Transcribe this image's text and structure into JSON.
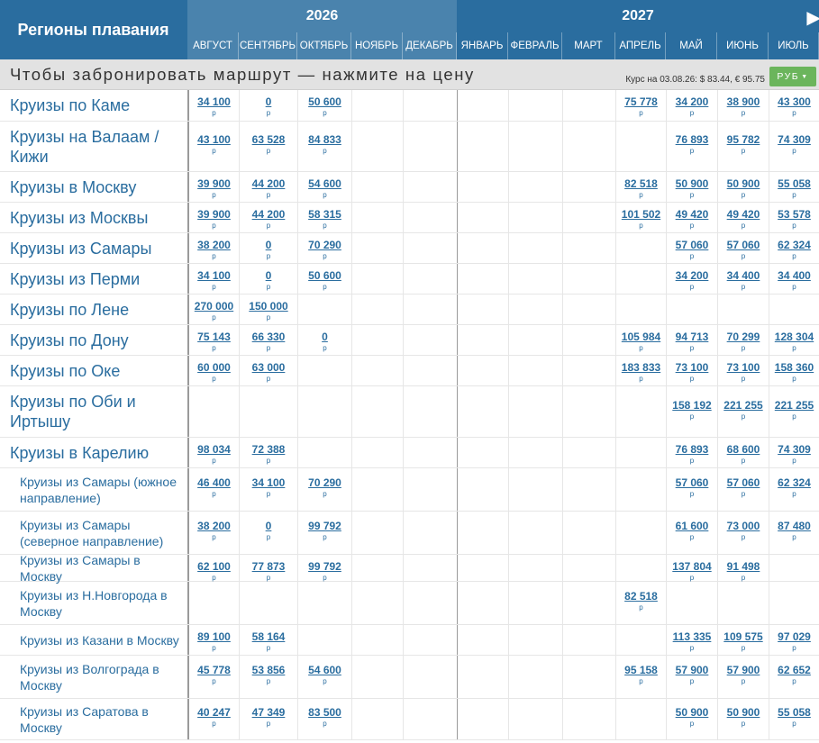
{
  "header": {
    "regions_title": "Регионы плавания",
    "years": [
      "2026",
      "2027"
    ],
    "months": [
      {
        "label": "АВГУСТ",
        "year": "2026"
      },
      {
        "label": "СЕНТЯБРЬ",
        "year": "2026"
      },
      {
        "label": "ОКТЯБРЬ",
        "year": "2026"
      },
      {
        "label": "НОЯБРЬ",
        "year": "2026"
      },
      {
        "label": "ДЕКАБРЬ",
        "year": "2026"
      },
      {
        "label": "ЯНВАРЬ",
        "year": "2027"
      },
      {
        "label": "ФЕВРАЛЬ",
        "year": "2027"
      },
      {
        "label": "МАРТ",
        "year": "2027"
      },
      {
        "label": "АПРЕЛЬ",
        "year": "2027"
      },
      {
        "label": "МАЙ",
        "year": "2027"
      },
      {
        "label": "ИЮНЬ",
        "year": "2027"
      },
      {
        "label": "ИЮЛЬ",
        "year": "2027"
      }
    ],
    "next_icon": "triangle-right-icon"
  },
  "notice": {
    "text": "Чтобы забронировать маршрут — нажмите на цену",
    "rate": "Курс на 03.08.26: $ 83.44, € 95.75",
    "currency_label": "РУБ",
    "currency_icon": "caret-down-icon"
  },
  "currency_symbol": "р",
  "colors": {
    "header": "#2a6d9f",
    "header_2026": "#4a83ad",
    "link": "#2a6d9f",
    "currency_button": "#6bb55c"
  },
  "rows": [
    {
      "name": "Круизы по Каме",
      "size": "big",
      "prices": [
        "34 100",
        "0",
        "50 600",
        "",
        "",
        "",
        "",
        "",
        "75 778",
        "34 200",
        "38 900",
        "43 300"
      ]
    },
    {
      "name": "Круизы на Валаам / Кижи",
      "size": "big",
      "prices": [
        "43 100",
        "63 528",
        "84 833",
        "",
        "",
        "",
        "",
        "",
        "",
        "76 893",
        "95 782",
        "74 309"
      ]
    },
    {
      "name": "Круизы в Москву",
      "size": "big",
      "prices": [
        "39 900",
        "44 200",
        "54 600",
        "",
        "",
        "",
        "",
        "",
        "82 518",
        "50 900",
        "50 900",
        "55 058"
      ]
    },
    {
      "name": "Круизы из Москвы",
      "size": "big",
      "prices": [
        "39 900",
        "44 200",
        "58 315",
        "",
        "",
        "",
        "",
        "",
        "101 502",
        "49 420",
        "49 420",
        "53 578"
      ]
    },
    {
      "name": "Круизы из Самары",
      "size": "big",
      "prices": [
        "38 200",
        "0",
        "70 290",
        "",
        "",
        "",
        "",
        "",
        "",
        "57 060",
        "57 060",
        "62 324"
      ]
    },
    {
      "name": "Круизы из Перми",
      "size": "big",
      "prices": [
        "34 100",
        "0",
        "50 600",
        "",
        "",
        "",
        "",
        "",
        "",
        "34 200",
        "34 400",
        "34 400"
      ]
    },
    {
      "name": "Круизы по Лене",
      "size": "big",
      "prices": [
        "270 000",
        "150 000",
        "",
        "",
        "",
        "",
        "",
        "",
        "",
        "",
        "",
        ""
      ]
    },
    {
      "name": "Круизы по Дону",
      "size": "big",
      "prices": [
        "75 143",
        "66 330",
        "0",
        "",
        "",
        "",
        "",
        "",
        "105 984",
        "94 713",
        "70 299",
        "128 304"
      ]
    },
    {
      "name": "Круизы по Оке",
      "size": "big",
      "prices": [
        "60 000",
        "63 000",
        "",
        "",
        "",
        "",
        "",
        "",
        "183 833",
        "73 100",
        "73 100",
        "158 360"
      ]
    },
    {
      "name": "Круизы по Оби и Иртышу",
      "size": "big",
      "prices": [
        "",
        "",
        "",
        "",
        "",
        "",
        "",
        "",
        "",
        "158 192",
        "221 255",
        "221 255"
      ]
    },
    {
      "name": "Круизы в Карелию",
      "size": "big",
      "prices": [
        "98 034",
        "72 388",
        "",
        "",
        "",
        "",
        "",
        "",
        "",
        "76 893",
        "68 600",
        "74 309"
      ]
    },
    {
      "name": "Круизы из Самары (южное направление)",
      "size": "small",
      "prices": [
        "46 400",
        "34 100",
        "70 290",
        "",
        "",
        "",
        "",
        "",
        "",
        "57 060",
        "57 060",
        "62 324"
      ]
    },
    {
      "name": "Круизы из Самары (северное направление)",
      "size": "small",
      "prices": [
        "38 200",
        "0",
        "99 792",
        "",
        "",
        "",
        "",
        "",
        "",
        "61 600",
        "73 000",
        "87 480"
      ]
    },
    {
      "name": "Круизы из Самары в Москву",
      "size": "small",
      "prices": [
        "62 100",
        "77 873",
        "99 792",
        "",
        "",
        "",
        "",
        "",
        "",
        "137 804",
        "91 498",
        ""
      ]
    },
    {
      "name": "Круизы из Н.Новгорода в Москву",
      "size": "small",
      "prices": [
        "",
        "",
        "",
        "",
        "",
        "",
        "",
        "",
        "82 518",
        "",
        "",
        ""
      ]
    },
    {
      "name": "Круизы из Казани в Москву",
      "size": "small",
      "prices": [
        "89 100",
        "58 164",
        "",
        "",
        "",
        "",
        "",
        "",
        "",
        "113 335",
        "109 575",
        "97 029"
      ]
    },
    {
      "name": "Круизы из Волгограда в Москву",
      "size": "small",
      "prices": [
        "45 778",
        "53 856",
        "54 600",
        "",
        "",
        "",
        "",
        "",
        "95 158",
        "57 900",
        "57 900",
        "62 652"
      ]
    },
    {
      "name": "Круизы из Саратова в Москву",
      "size": "small",
      "prices": [
        "40 247",
        "47 349",
        "83 500",
        "",
        "",
        "",
        "",
        "",
        "",
        "50 900",
        "50 900",
        "55 058"
      ]
    }
  ]
}
